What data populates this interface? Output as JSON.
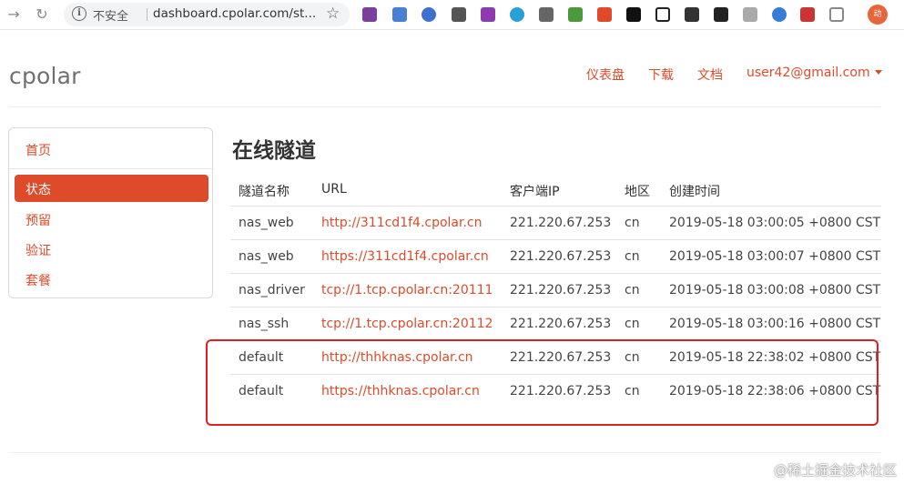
{
  "browser": {
    "insecure_label": "不安全",
    "url": "dashboard.cpolar.com/st...",
    "profile_initial": "动"
  },
  "site": {
    "logo": "cpolar",
    "nav": {
      "dashboard": "仪表盘",
      "download": "下载",
      "docs": "文档",
      "user": "user42@gmail.com"
    }
  },
  "sidebar": {
    "home": "首页",
    "status": "状态",
    "reserve": "预留",
    "verify": "验证",
    "plan": "套餐"
  },
  "main": {
    "title": "在线隧道",
    "columns": [
      "隧道名称",
      "URL",
      "客户端IP",
      "地区",
      "创建时间"
    ],
    "rows": [
      [
        "nas_web",
        "http://311cd1f4.cpolar.cn",
        "221.220.67.253",
        "cn",
        "2019-05-18 03:00:05 +0800 CST"
      ],
      [
        "nas_web",
        "https://311cd1f4.cpolar.cn",
        "221.220.67.253",
        "cn",
        "2019-05-18 03:00:07 +0800 CST"
      ],
      [
        "nas_driver",
        "tcp://1.tcp.cpolar.cn:20111",
        "221.220.67.253",
        "cn",
        "2019-05-18 03:00:08 +0800 CST"
      ],
      [
        "nas_ssh",
        "tcp://1.tcp.cpolar.cn:20112",
        "221.220.67.253",
        "cn",
        "2019-05-18 03:00:16 +0800 CST"
      ],
      [
        "default",
        "http://thhknas.cpolar.cn",
        "221.220.67.253",
        "cn",
        "2019-05-18 22:38:02 +0800 CST"
      ],
      [
        "default",
        "https://thhknas.cpolar.cn",
        "221.220.67.253",
        "cn",
        "2019-05-18 22:38:06 +0800 CST"
      ]
    ]
  },
  "watermark": "@稀土掘金技术社区",
  "colors": {
    "accent": "#dd4b2a",
    "highlight": "#e02020"
  }
}
